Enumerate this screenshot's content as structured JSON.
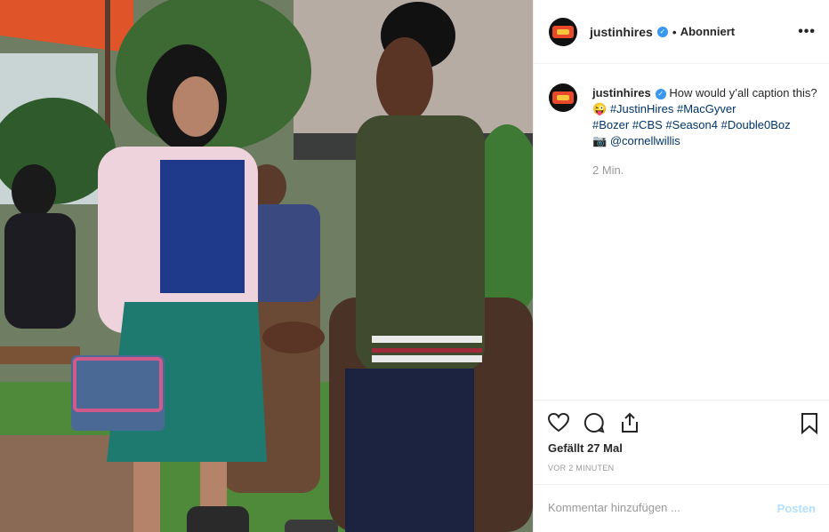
{
  "header": {
    "username": "justinhires",
    "follow_status": "Abonniert",
    "more_icon": "more-horizontal-icon"
  },
  "caption": {
    "username": "justinhires",
    "text_start": "How would y’all caption this?😜",
    "hashtags": [
      "#JustinHires",
      "#MacGyver",
      "#Bozer",
      "#CBS",
      "#Season4",
      "#Double0Boz"
    ],
    "camera_glyph": "📷",
    "mention": "@cornellwillis",
    "time_ago": "2 Min."
  },
  "actions": {
    "like_icon": "heart-icon",
    "comment_icon": "comment-icon",
    "share_icon": "share-icon",
    "save_icon": "bookmark-icon"
  },
  "likes_text": "Gefällt 27 Mal",
  "posted_text": "VOR 2 MINUTEN",
  "comment": {
    "placeholder": "Kommentar hinzufügen ...",
    "post_label": "Posten"
  },
  "colors": {
    "verified": "#3897f0",
    "link": "#003569",
    "post_disabled": "#b2dffc"
  }
}
